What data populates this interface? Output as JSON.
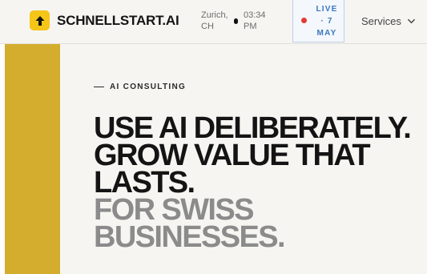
{
  "header": {
    "brand": "SCHNELLSTART.AI",
    "location_line1": "Zurich,",
    "location_line2": "CH",
    "time_line1": "03:34",
    "time_line2": "PM",
    "live_line1": "LIVE",
    "live_line2": "· 7",
    "live_line3": "MAY",
    "services_label": "Services"
  },
  "hero": {
    "eyebrow": "AI CONSULTING",
    "headline_lines": [
      "USE AI DELIBERATELY.",
      "GROW VALUE THAT",
      "LASTS."
    ],
    "subline_lines": [
      "FOR SWISS",
      "BUSINESSES."
    ]
  },
  "colors": {
    "accent_yellow": "#f5c518",
    "side_bar": "#d4ad2f",
    "live_red": "#e53935",
    "live_blue": "#3a78c2",
    "muted_text": "#8b8b8b"
  },
  "icons": {
    "logo": "arrow-up-icon",
    "services": "chevron-down-icon"
  }
}
